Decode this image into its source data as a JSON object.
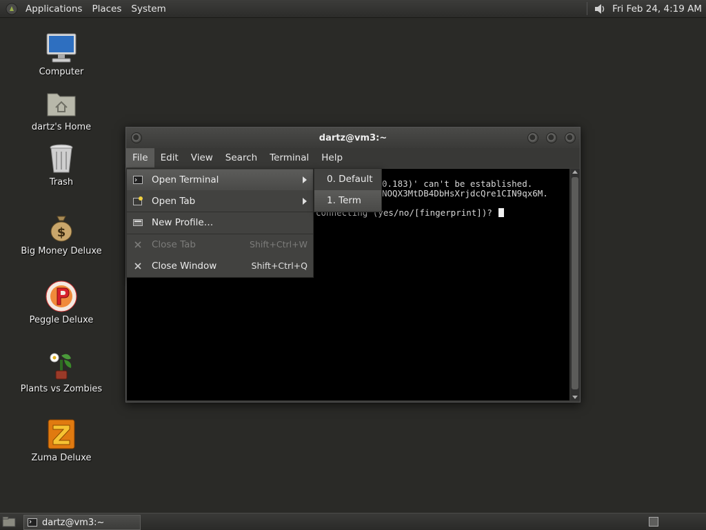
{
  "top_panel": {
    "menus": [
      "Applications",
      "Places",
      "System"
    ],
    "clock": "Fri Feb 24,  4:19 AM",
    "icons": {
      "logo": "gnome-foot-icon",
      "volume": "speaker-icon"
    }
  },
  "desktop": {
    "icons": [
      {
        "label": "Computer",
        "icon": "computer-icon"
      },
      {
        "label": "dartz's Home",
        "icon": "home-folder-icon"
      },
      {
        "label": "Trash",
        "icon": "trash-icon"
      },
      {
        "label": "Big Money Deluxe",
        "icon": "money-bag-icon"
      },
      {
        "label": "Peggle Deluxe",
        "icon": "peggle-icon"
      },
      {
        "label": "Plants vs Zombies",
        "icon": "plants-vs-zombies-icon"
      },
      {
        "label": "Zuma Deluxe",
        "icon": "zuma-icon"
      }
    ]
  },
  "window": {
    "title": "dartz@vm3:~",
    "menubar": [
      "File",
      "Edit",
      "View",
      "Search",
      "Terminal",
      "Help"
    ],
    "active_menu": "File",
    "terminal_lines": [
      "0.183)' can't be established.",
      "NOQX3MtDB4DbHsXrjdcQre1CIN9qx6M.",
      "connecting (yes/no/[fingerprint])? "
    ]
  },
  "file_menu": {
    "items": [
      {
        "label": "Open Terminal",
        "accel": "",
        "submenu": true,
        "disabled": false,
        "icon": "terminal-icon"
      },
      {
        "label": "Open Tab",
        "accel": "",
        "submenu": true,
        "disabled": false,
        "icon": "new-tab-icon"
      },
      {
        "label": "New Profile…",
        "accel": "",
        "submenu": false,
        "disabled": false,
        "icon": "profile-icon"
      },
      {
        "label": "Close Tab",
        "accel": "Shift+Ctrl+W",
        "submenu": false,
        "disabled": true,
        "icon": "close-icon"
      },
      {
        "label": "Close Window",
        "accel": "Shift+Ctrl+Q",
        "submenu": false,
        "disabled": false,
        "icon": "close-icon"
      }
    ],
    "highlighted": "Open Terminal"
  },
  "submenu": {
    "items": [
      "0. Default",
      "1. Term"
    ],
    "highlighted": "1. Term"
  },
  "bottom_panel": {
    "task_label": "dartz@vm3:~",
    "icons": {
      "show_desktop": "show-desktop-icon",
      "workspace": "workspace-switcher-icon"
    }
  },
  "colors": {
    "desktop_bg": "#2a2a27",
    "panel_bg": "#333331",
    "menu_bg": "#424240",
    "menu_highlight": "#555553",
    "terminal_bg": "#000000"
  }
}
